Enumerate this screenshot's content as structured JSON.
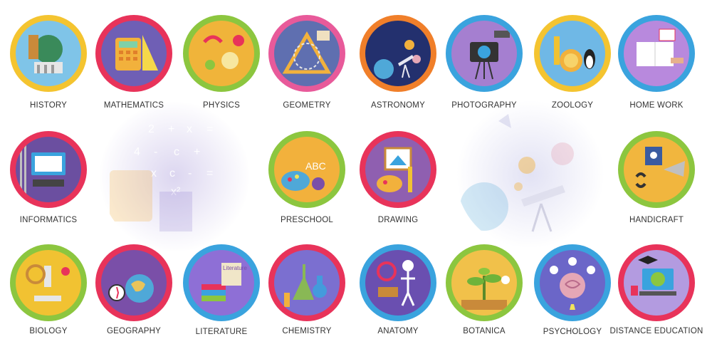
{
  "subjects": [
    {
      "label": "HISTORY",
      "icon": "hourglass-globe-icon",
      "ring": "#f4c430",
      "bg": "#7fc4e8"
    },
    {
      "label": "MATHEMATICS",
      "icon": "calculator-icon",
      "ring": "#e8335a",
      "bg": "#6f5fb5"
    },
    {
      "label": "PHYSICS",
      "icon": "magnet-bulb-icon",
      "ring": "#8cc63f",
      "bg": "#f0b43a"
    },
    {
      "label": "GEOMETRY",
      "icon": "ruler-compass-icon",
      "ring": "#e85a9a",
      "bg": "#5f6fb0"
    },
    {
      "label": "ASTRONOMY",
      "icon": "telescope-planet-icon",
      "ring": "#f07f2a",
      "bg": "#23306e"
    },
    {
      "label": "PHOTOGRAPHY",
      "icon": "camera-icon",
      "ring": "#3aa3de",
      "bg": "#a57fd0"
    },
    {
      "label": "ZOOLOGY",
      "icon": "lion-penguin-icon",
      "ring": "#f4c430",
      "bg": "#6fb8e6"
    },
    {
      "label": "HOME WORK",
      "icon": "notebook-hand-icon",
      "ring": "#3aa3de",
      "bg": "#b889dd"
    },
    {
      "label": "INFORMATICS",
      "icon": "computer-icon",
      "ring": "#e8335a",
      "bg": "#6b4fa0"
    },
    {
      "label": "PRESCHOOL",
      "icon": "palette-abc-icon",
      "ring": "#8cc63f",
      "bg": "#f2b13c"
    },
    {
      "label": "DRAWING",
      "icon": "easel-brush-icon",
      "ring": "#e8335a",
      "bg": "#8f5fb0"
    },
    {
      "label": "HANDICRAFT",
      "icon": "saw-tools-icon",
      "ring": "#8cc63f",
      "bg": "#f1b63e"
    },
    {
      "label": "BIOLOGY",
      "icon": "microscope-icon",
      "ring": "#8cc63f",
      "bg": "#f1c232"
    },
    {
      "label": "GEOGRAPHY",
      "icon": "globe-compass-icon",
      "ring": "#e8335a",
      "bg": "#7a4fa8"
    },
    {
      "label": "LITERATURE",
      "icon": "books-scroll-icon",
      "ring": "#3aa3de",
      "bg": "#8e6fd6"
    },
    {
      "label": "CHEMISTRY",
      "icon": "flask-icon",
      "ring": "#e8335a",
      "bg": "#7b6fd0"
    },
    {
      "label": "ANATOMY",
      "icon": "skeleton-icon",
      "ring": "#3aa3de",
      "bg": "#6a4fb0"
    },
    {
      "label": "BOTANICA",
      "icon": "plant-sprout-icon",
      "ring": "#8cc63f",
      "bg": "#f1c14a"
    },
    {
      "label": "PSYCHOLOGY",
      "icon": "brain-icon",
      "ring": "#3aa3de",
      "bg": "#6b66c8"
    },
    {
      "label": "DISTANCE EDUCATION",
      "icon": "laptop-globe-icon",
      "ring": "#e8335a",
      "bg": "#b39be0"
    }
  ],
  "ghosts": [
    {
      "icon": "calculator-ghost-icon",
      "text": [
        "2",
        "+",
        "x",
        "=",
        "4",
        "-",
        "c",
        "+",
        "x",
        "c",
        "-",
        "x²",
        "="
      ],
      "bg": "#dcd6f0"
    },
    {
      "icon": "telescope-ghost-icon",
      "bg": "#e2e2f4"
    }
  ]
}
